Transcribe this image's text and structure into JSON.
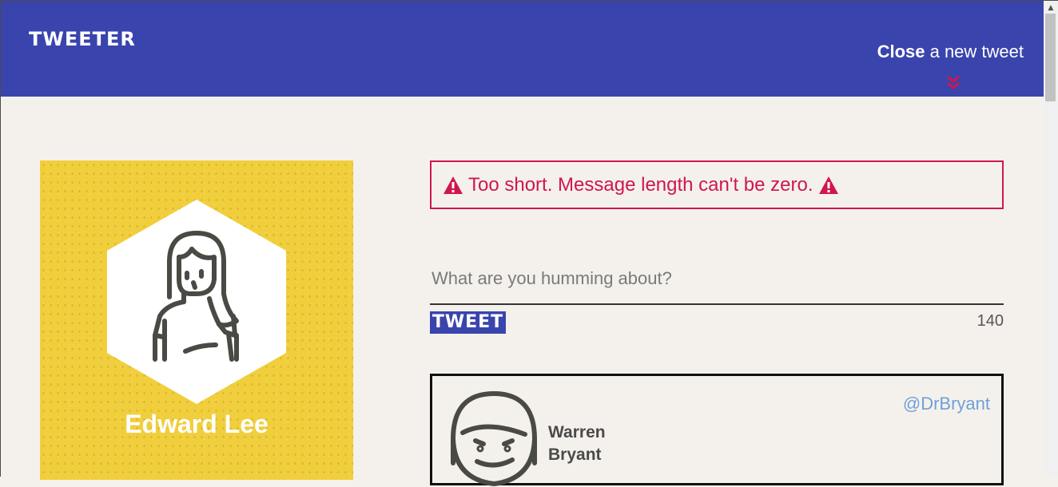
{
  "header": {
    "brand": "TWEETER",
    "compose_toggle": {
      "bold": "Close",
      "rest": " a new tweet"
    },
    "chevron_color": "#d0174b"
  },
  "profile": {
    "name": "Edward Lee",
    "card_color": "#f1ce3c",
    "avatar_icon": "woman-avatar-icon"
  },
  "compose": {
    "error": "Too short. Message length can't be zero.",
    "placeholder": "What are you humming about?",
    "value": "",
    "submit_label": "TWEET",
    "char_count": "140"
  },
  "tweets": [
    {
      "author_line1": "Warren",
      "author_line2": "Bryant",
      "handle": "@DrBryant",
      "avatar_icon": "man-avatar-icon"
    }
  ],
  "colors": {
    "header": "#3a44ad",
    "background": "#f4f1ec",
    "error": "#d0174b",
    "handle": "#6fa0d8"
  }
}
